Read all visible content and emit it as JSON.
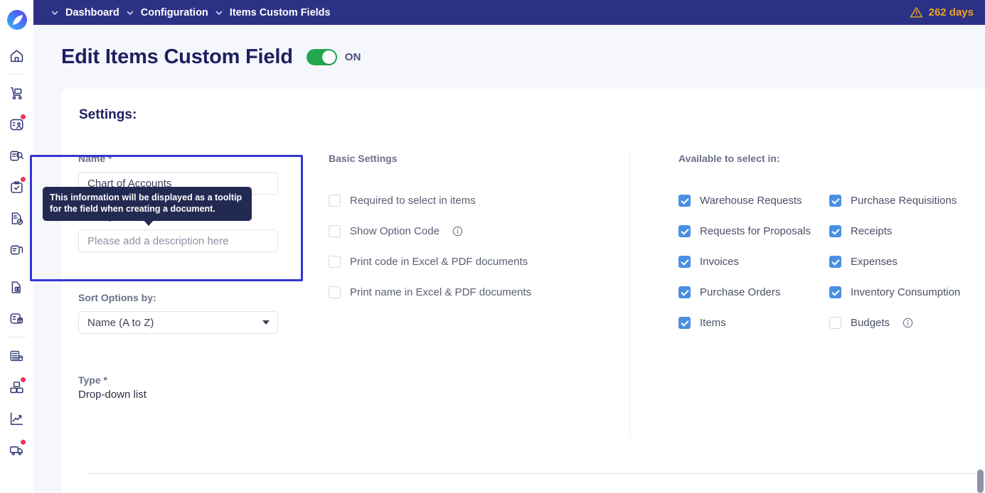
{
  "topbar": {
    "breadcrumbs": [
      {
        "label": "Dashboard",
        "icon": "chevron-down-icon"
      },
      {
        "label": "Configuration",
        "icon": "chevron-down-icon"
      },
      {
        "label": "Items Custom Fields",
        "icon": "chevron-down-icon"
      }
    ],
    "trial": {
      "icon": "warning-triangle-icon",
      "label": "262 days"
    },
    "background": "#2b3285"
  },
  "sidebar": {
    "logo": "app-logo",
    "items": [
      {
        "name": "home-icon",
        "badge": false
      },
      {
        "name": "delivery-cart-icon",
        "badge": false
      },
      {
        "name": "user-tasks-icon",
        "badge": true
      },
      {
        "name": "document-search-icon",
        "badge": false
      },
      {
        "name": "approval-checklist-icon",
        "badge": true
      },
      {
        "name": "document-check-icon",
        "badge": false
      },
      {
        "name": "file-receipt-icon",
        "badge": false
      },
      {
        "name": "file-lock-icon",
        "badge": false
      },
      {
        "name": "list-database-icon",
        "badge": false
      },
      {
        "name": "calculator-database-icon",
        "badge": false
      },
      {
        "name": "inventory-blocks-icon",
        "badge": true
      },
      {
        "name": "analytics-trend-icon",
        "badge": false
      },
      {
        "name": "shipping-truck-icon",
        "badge": true
      }
    ]
  },
  "header": {
    "title": "Edit Items Custom Field",
    "toggle": {
      "state": "on",
      "label": "ON",
      "color": "#21a84f"
    }
  },
  "card": {
    "title": "Settings:",
    "left": {
      "name_label": "Name *",
      "name_value": "Chart of Accounts",
      "description_label": "Description",
      "description_info_icon": "info-circle-icon",
      "description_placeholder": "Please add a description here",
      "sort_label": "Sort Options by:",
      "sort_value": "Name (A to Z)",
      "type_label": "Type *",
      "type_value": "Drop-down list"
    },
    "basic_settings": {
      "heading": "Basic Settings",
      "items": [
        {
          "label": "Required to select in items",
          "checked": false,
          "info": false
        },
        {
          "label": "Show Option Code",
          "checked": false,
          "info": true
        },
        {
          "label": "Print code in Excel & PDF documents",
          "checked": false,
          "info": false
        },
        {
          "label": "Print name in Excel & PDF documents",
          "checked": false,
          "info": false
        }
      ]
    },
    "available_in": {
      "heading": "Available to select in:",
      "items": [
        {
          "label": "Warehouse Requests",
          "checked": true,
          "info": false
        },
        {
          "label": "Purchase Requisitions",
          "checked": true,
          "info": false
        },
        {
          "label": "Requests for Proposals",
          "checked": true,
          "info": false
        },
        {
          "label": "Receipts",
          "checked": true,
          "info": false
        },
        {
          "label": "Invoices",
          "checked": true,
          "info": false
        },
        {
          "label": "Expenses",
          "checked": true,
          "info": false
        },
        {
          "label": "Purchase Orders",
          "checked": true,
          "info": false
        },
        {
          "label": "Inventory Consumption",
          "checked": true,
          "info": false
        },
        {
          "label": "Items",
          "checked": true,
          "info": false
        },
        {
          "label": "Budgets",
          "checked": false,
          "info": true
        }
      ]
    }
  },
  "tooltip": {
    "text": "This information will be displayed as a tooltip for the field when creating a document."
  },
  "colors": {
    "accent": "#2b3285",
    "highlight_border": "#3535d4",
    "checkbox_on": "#4a90e2",
    "toggle_on": "#21a84f",
    "warning": "#f0a020"
  }
}
